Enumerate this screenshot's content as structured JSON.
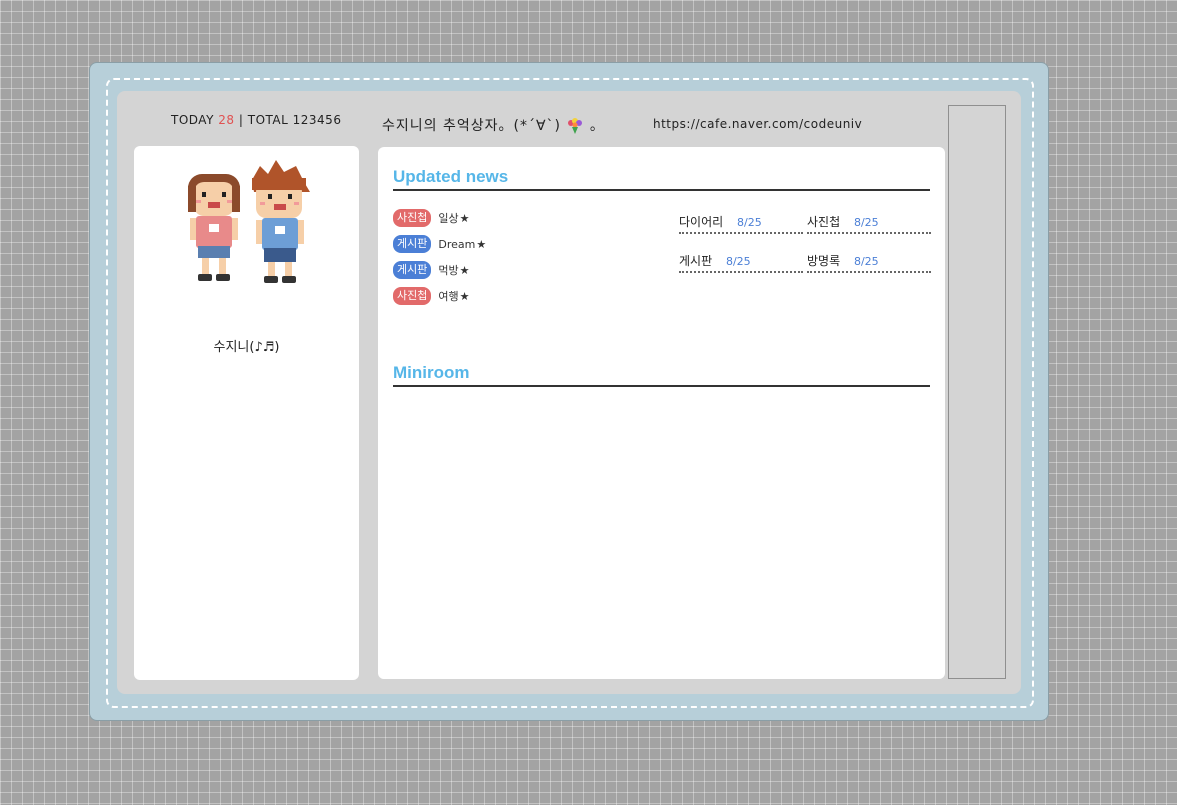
{
  "header": {
    "today_label": "TODAY",
    "today_count": "28",
    "separator": "|",
    "total_label": "TOTAL",
    "total_count": "123456",
    "title": "수지니의 추억상자。(*´∀`)",
    "title_suffix": "。",
    "url": "https://cafe.naver.com/codeuniv"
  },
  "profile": {
    "name": "수지니(♪♬)"
  },
  "updated_news": {
    "title": "Updated news",
    "items": [
      {
        "tag": "사진첩",
        "tag_color": "#e26a6a",
        "text": "일상",
        "star": "★"
      },
      {
        "tag": "게시판",
        "tag_color": "#4b7fd6",
        "text": "Dream",
        "star": "★"
      },
      {
        "tag": "게시판",
        "tag_color": "#4b7fd6",
        "text": "먹방",
        "star": "★"
      },
      {
        "tag": "사진첩",
        "tag_color": "#e26a6a",
        "text": "여행",
        "star": "★"
      }
    ]
  },
  "menu": {
    "items": [
      {
        "label": "다이어리",
        "count": "8/25"
      },
      {
        "label": "사진첩",
        "count": "8/25"
      },
      {
        "label": "게시판",
        "count": "8/25"
      },
      {
        "label": "방명록",
        "count": "8/25"
      }
    ]
  },
  "miniroom": {
    "title": "Miniroom"
  },
  "colors": {
    "accent": "#56b6e8",
    "cover": "#b7cfd9",
    "count_blue": "#4b7fd6",
    "today_red": "#e05252"
  }
}
